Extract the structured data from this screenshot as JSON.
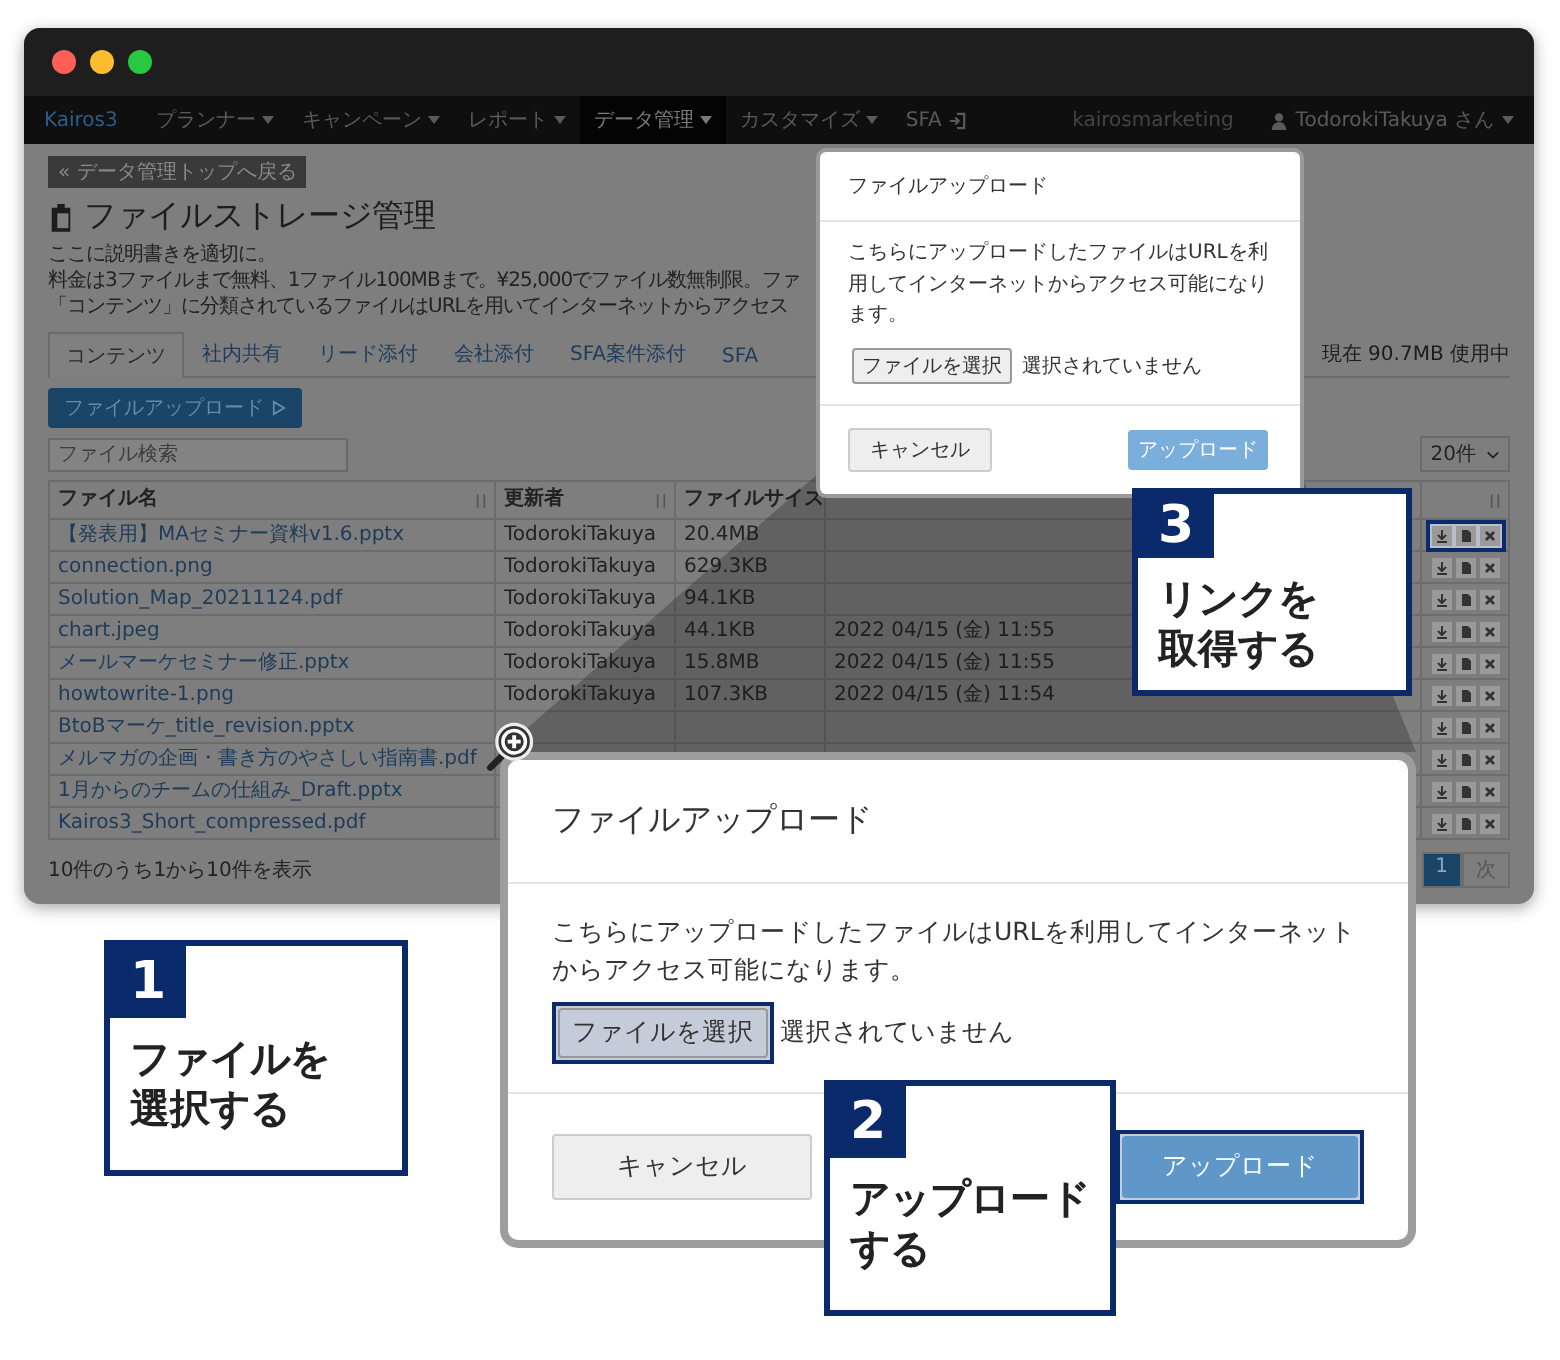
{
  "navbar": {
    "brand": "Kairos3",
    "items": [
      {
        "label": "プランナー",
        "kind": "dropdown",
        "selected": false
      },
      {
        "label": "キャンペーン",
        "kind": "dropdown",
        "selected": false
      },
      {
        "label": "レポート",
        "kind": "dropdown",
        "selected": false
      },
      {
        "label": "データ管理",
        "kind": "dropdown",
        "selected": true
      },
      {
        "label": "カスタマイズ",
        "kind": "dropdown",
        "selected": false
      },
      {
        "label": "SFA",
        "kind": "external",
        "selected": false
      }
    ],
    "account": "kairosmarketing",
    "user": "TodorokiTakuya さん"
  },
  "page": {
    "back_button": "« データ管理トップへ戻る",
    "title": "ファイルストレージ管理",
    "description": [
      "ここに説明書きを適切に。",
      "料金は3ファイルまで無料、1ファイル100MBまで。¥25,000でファイル数無制限。ファ",
      "「コンテンツ」に分類されているファイルはURLを用いてインターネットからアクセス"
    ],
    "tabs": [
      {
        "label": "コンテンツ",
        "selected": true
      },
      {
        "label": "社内共有",
        "selected": false
      },
      {
        "label": "リード添付",
        "selected": false
      },
      {
        "label": "会社添付",
        "selected": false
      },
      {
        "label": "SFA案件添付",
        "selected": false
      },
      {
        "label": "SFA",
        "selected": false
      }
    ],
    "usage": "現在 90.7MB 使用中",
    "upload_button": "ファイルアップロード",
    "search": {
      "placeholder": "ファイル検索"
    },
    "page_size": "20件",
    "table": {
      "columns": [
        "ファイル名",
        "更新者",
        "ファイルサイズ"
      ],
      "rows": [
        {
          "name": "【発表用】MAセミナー資料v1.6.pptx",
          "updater": "TodorokiTakuya",
          "size": "20.4MB",
          "highlighted": true
        },
        {
          "name": "connection.png",
          "updater": "TodorokiTakuya",
          "size": "629.3KB",
          "highlighted": false
        },
        {
          "name": "Solution_Map_20211124.pdf",
          "updater": "TodorokiTakuya",
          "size": "94.1KB",
          "highlighted": false
        },
        {
          "name": "chart.jpeg",
          "updater": "TodorokiTakuya",
          "size": "44.1KB",
          "date": "2022 04/15 (金) 11:55",
          "highlighted": false
        },
        {
          "name": "メールマーケセミナー修正.pptx",
          "updater": "TodorokiTakuya",
          "size": "15.8MB",
          "date": "2022 04/15 (金) 11:55",
          "highlighted": false
        },
        {
          "name": "howtowrite-1.png",
          "updater": "TodorokiTakuya",
          "size": "107.3KB",
          "date": "2022 04/15 (金) 11:54",
          "highlighted": false
        },
        {
          "name": "BtoBマーケ_title_revision.pptx",
          "highlighted": false
        },
        {
          "name": "メルマガの企画・書き方のやさしい指南書.pdf",
          "highlighted": false
        },
        {
          "name": "1月からのチームの仕組み_Draft.pptx",
          "highlighted": false
        },
        {
          "name": "Kairos3_Short_compressed.pdf",
          "highlighted": false
        }
      ]
    },
    "summary": "10件のうち1から10件を表示",
    "pagination": [
      {
        "label": "1",
        "selected": true
      },
      {
        "label": "次",
        "selected": false
      }
    ]
  },
  "dialogs": [
    {
      "title": "ファイルアップロード",
      "message": "こちらにアップロードしたファイルはURLを利用してインターネットからアクセス可能になります。",
      "file_button": {
        "label": "ファイルを選択",
        "highlighted": false
      },
      "file_status": "選択されていません",
      "cancel_button": "キャンセル",
      "submit_button": {
        "label": "アップロード",
        "highlighted": false
      }
    },
    {
      "title": "ファイルアップロード",
      "message": "こちらにアップロードしたファイルはURLを利用してインターネットからアクセス可能になります。",
      "file_button": {
        "label": "ファイルを選択",
        "highlighted": true
      },
      "file_status": "選択されていません",
      "cancel_button": "キャンセル",
      "submit_button": {
        "label": "アップロード",
        "highlighted": true
      }
    }
  ],
  "callouts": [
    {
      "number": "1",
      "lines": [
        "ファイルを",
        "選択する"
      ]
    },
    {
      "number": "2",
      "lines": [
        "アップロード",
        "する"
      ]
    },
    {
      "number": "3",
      "lines": [
        "リンクを",
        "取得する"
      ]
    }
  ]
}
